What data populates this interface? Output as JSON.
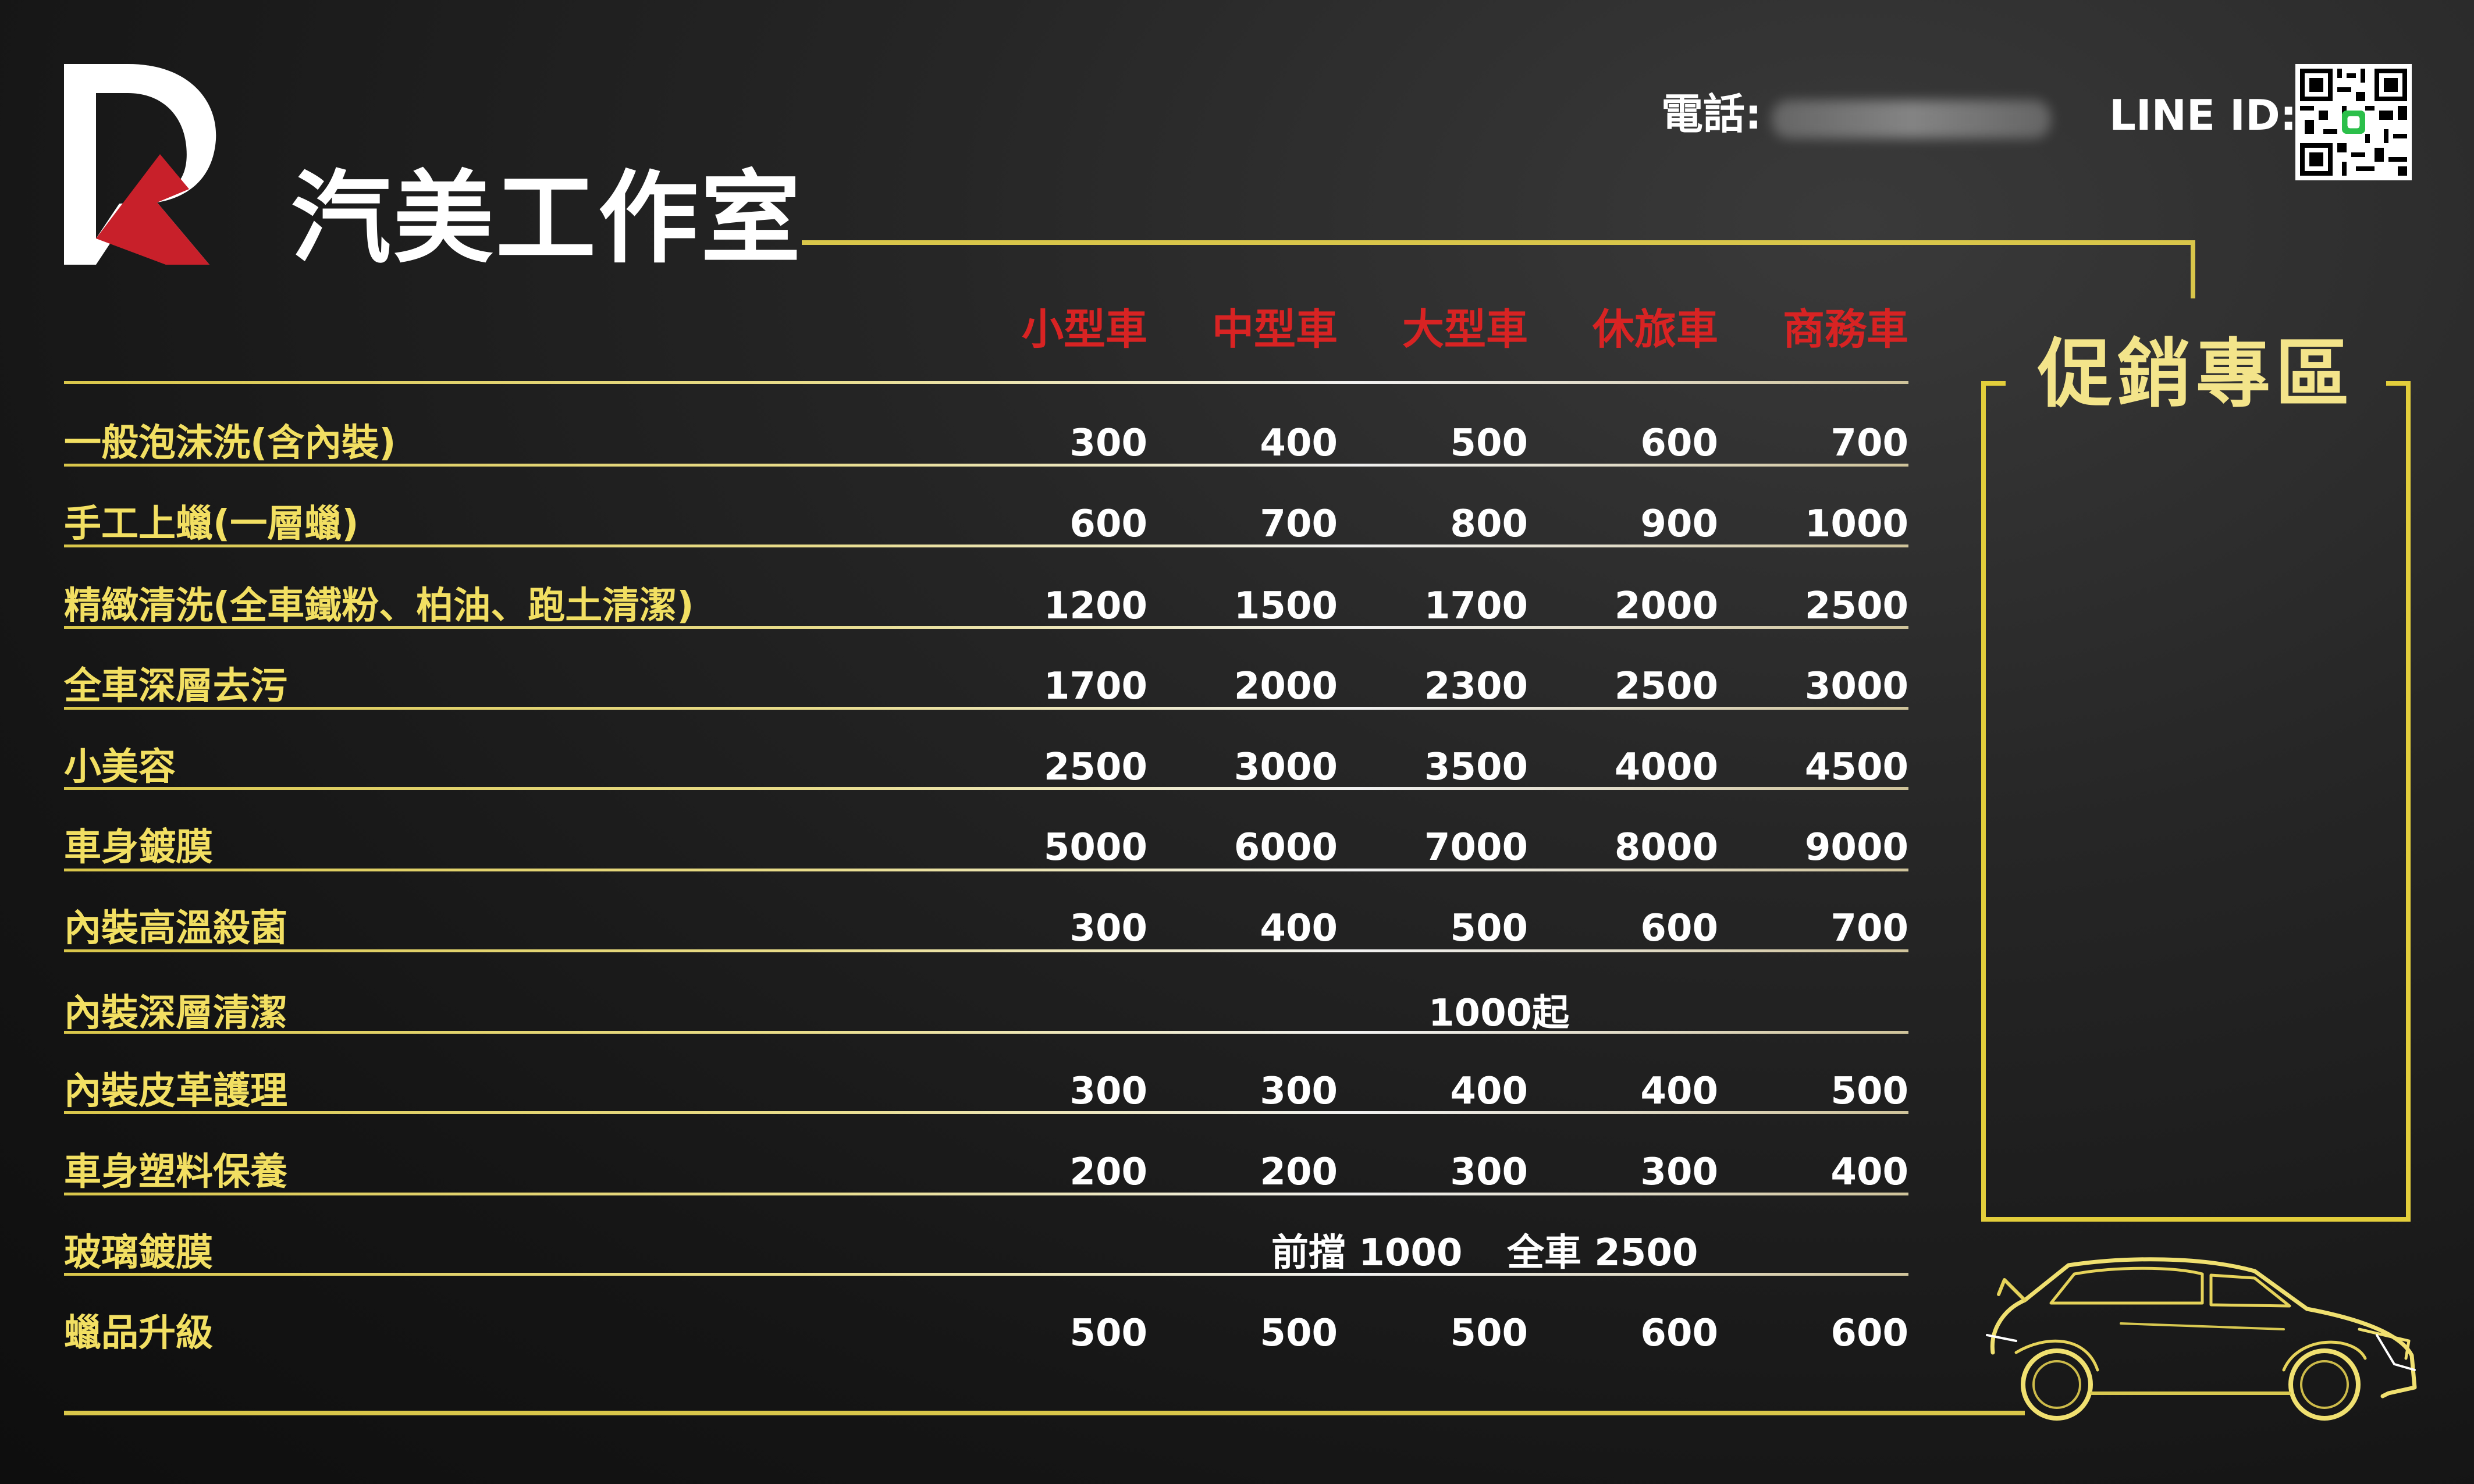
{
  "brand": {
    "name": "汽美工作室"
  },
  "contact": {
    "phone_label": "電話:",
    "line_label": "LINE ID:"
  },
  "promo": {
    "title": "促銷專區"
  },
  "table": {
    "headers": [
      "小型車",
      "中型車",
      "大型車",
      "休旅車",
      "商務車"
    ],
    "rows": [
      {
        "label": "一般泡沫洗(含內裝)",
        "prices": [
          "300",
          "400",
          "500",
          "600",
          "700"
        ]
      },
      {
        "label": "手工上蠟(一層蠟)",
        "prices": [
          "600",
          "700",
          "800",
          "900",
          "1000"
        ]
      },
      {
        "label": "精緻清洗(全車鐵粉、柏油、跑土清潔)",
        "prices": [
          "1200",
          "1500",
          "1700",
          "2000",
          "2500"
        ]
      },
      {
        "label": "全車深層去污",
        "prices": [
          "1700",
          "2000",
          "2300",
          "2500",
          "3000"
        ]
      },
      {
        "label": "小美容",
        "prices": [
          "2500",
          "3000",
          "3500",
          "4000",
          "4500"
        ]
      },
      {
        "label": "車身鍍膜",
        "prices": [
          "5000",
          "6000",
          "7000",
          "8000",
          "9000"
        ]
      },
      {
        "label": "內裝高溫殺菌",
        "prices": [
          "300",
          "400",
          "500",
          "600",
          "700"
        ]
      },
      {
        "label": "內裝深層清潔",
        "note": "1000起"
      },
      {
        "label": "內裝皮革護理",
        "prices": [
          "300",
          "300",
          "400",
          "400",
          "500"
        ]
      },
      {
        "label": "車身塑料保養",
        "prices": [
          "200",
          "200",
          "300",
          "300",
          "400"
        ]
      },
      {
        "label": "玻璃鍍膜",
        "notes": [
          "前擋 1000",
          "全車 2500"
        ]
      },
      {
        "label": "蠟品升級",
        "prices": [
          "500",
          "500",
          "500",
          "600",
          "600"
        ]
      }
    ]
  },
  "colors": {
    "gold": "#d9c64a",
    "header_red": "#d82323",
    "label_yellow": "#f2df62",
    "promo_title": "#f3e48a"
  }
}
